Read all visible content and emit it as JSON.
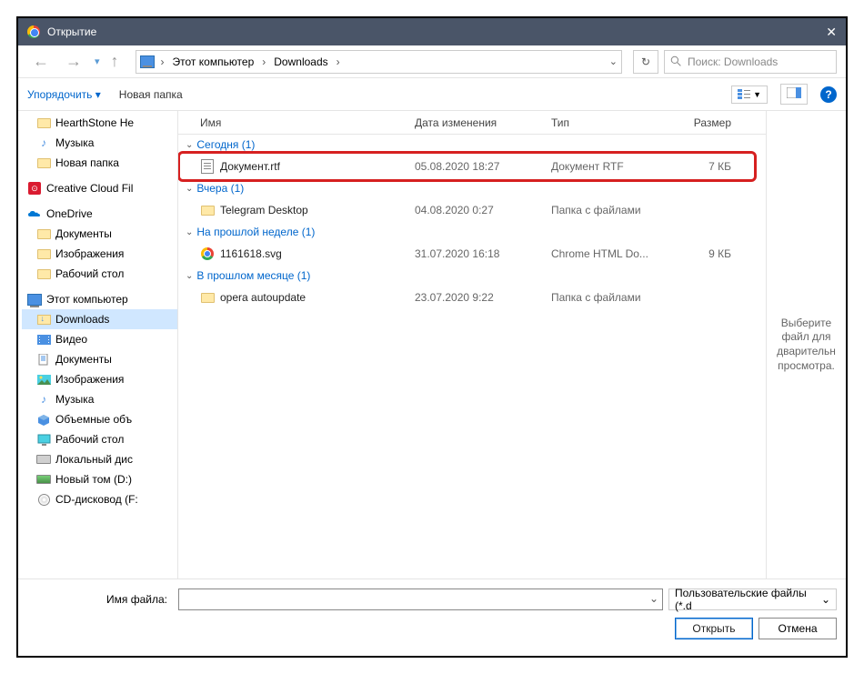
{
  "window": {
    "title": "Открытие"
  },
  "nav": {
    "crumb1": "Этот компьютер",
    "crumb2": "Downloads",
    "search_placeholder": "Поиск: Downloads"
  },
  "toolbar": {
    "organize": "Упорядочить",
    "new_folder": "Новая папка"
  },
  "tree": {
    "hearthstone": "HearthStone  He",
    "music1": "Музыка",
    "newfolder": "Новая папка",
    "creative_cloud": "Creative Cloud Fil",
    "onedrive": "OneDrive",
    "od_docs": "Документы",
    "od_images": "Изображения",
    "od_desktop": "Рабочий стол",
    "this_pc": "Этот компьютер",
    "downloads": "Downloads",
    "video": "Видео",
    "docs": "Документы",
    "images": "Изображения",
    "music2": "Музыка",
    "obj3d": "Объемные объ",
    "desktop": "Рабочий стол",
    "local_disk": "Локальный дис",
    "new_vol": "Новый том (D:)",
    "cd_drive": "CD-дисковод (F:"
  },
  "headers": {
    "name": "Имя",
    "date": "Дата изменения",
    "type": "Тип",
    "size": "Размер"
  },
  "groups": {
    "today": "Сегодня (1)",
    "yesterday": "Вчера (1)",
    "lastweek": "На прошлой неделе (1)",
    "lastmonth": "В прошлом месяце (1)"
  },
  "rows": {
    "r1": {
      "name": "Документ.rtf",
      "date": "05.08.2020 18:27",
      "type": "Документ RTF",
      "size": "7 КБ"
    },
    "r2": {
      "name": "Telegram Desktop",
      "date": "04.08.2020 0:27",
      "type": "Папка с файлами",
      "size": ""
    },
    "r3": {
      "name": "1161618.svg",
      "date": "31.07.2020 16:18",
      "type": "Chrome HTML Do...",
      "size": "9 КБ"
    },
    "r4": {
      "name": "opera autoupdate",
      "date": "23.07.2020 9:22",
      "type": "Папка с файлами",
      "size": ""
    }
  },
  "preview": {
    "text": "Выберите файл для дварительн просмотра."
  },
  "footer": {
    "filename_label": "Имя файла:",
    "filter": "Пользовательские файлы (*.d",
    "open": "Открыть",
    "cancel": "Отмена"
  }
}
